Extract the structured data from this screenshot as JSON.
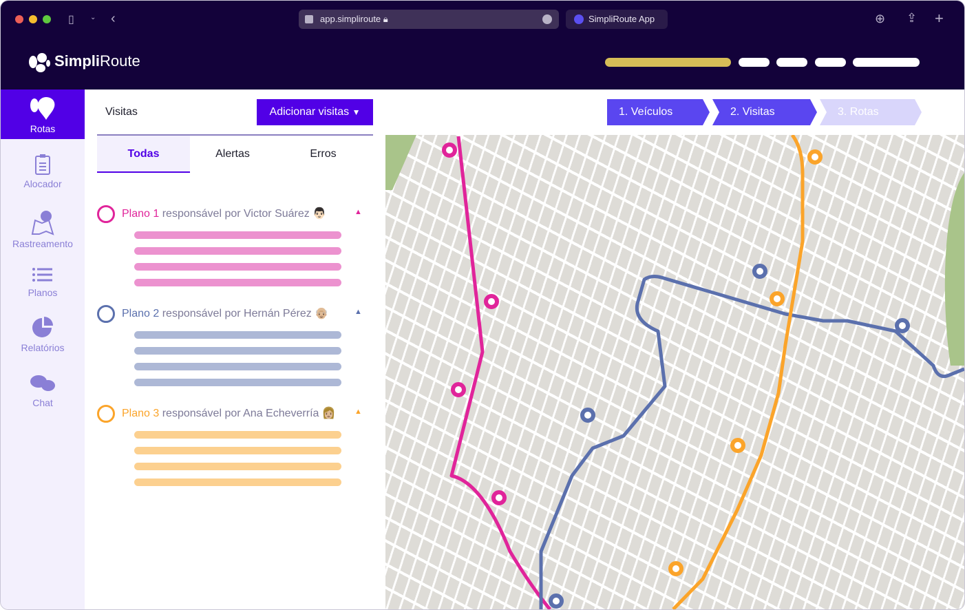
{
  "browser": {
    "url": "app.simpliroute",
    "tab": "SimpliRoute App"
  },
  "brand": {
    "name_bold": "Simpli",
    "name_light": "Route"
  },
  "sidebar": {
    "items": [
      {
        "label": "Rotas",
        "active": true
      },
      {
        "label": "Alocador"
      },
      {
        "label": "Rastreamento"
      },
      {
        "label": "Planos"
      },
      {
        "label": "Relatórios"
      },
      {
        "label": "Chat"
      }
    ]
  },
  "panel": {
    "title": "Visitas",
    "add_button": "Adicionar visitas",
    "tabs": [
      "Todas",
      "Alertas",
      "Erros"
    ],
    "plans": [
      {
        "name": "Plano 1",
        "owner": "responsável por Victor Suárez",
        "emoji": "👨🏻",
        "color": "#e0249a",
        "bar": "#ec92cf"
      },
      {
        "name": "Plano 2",
        "owner": "responsável por Hernán Pérez",
        "emoji": "👴🏼",
        "color": "#5b70ad",
        "bar": "#adb8d6"
      },
      {
        "name": "Plano 3",
        "owner": "responsável por Ana Echeverría",
        "emoji": "👩🏼",
        "color": "#fba42a",
        "bar": "#fcd08f"
      }
    ]
  },
  "steps": [
    "1. Veículos",
    "2. Visitas",
    "3. Rotas"
  ],
  "colors": {
    "primary": "#5100e6",
    "header": "#13023a"
  }
}
